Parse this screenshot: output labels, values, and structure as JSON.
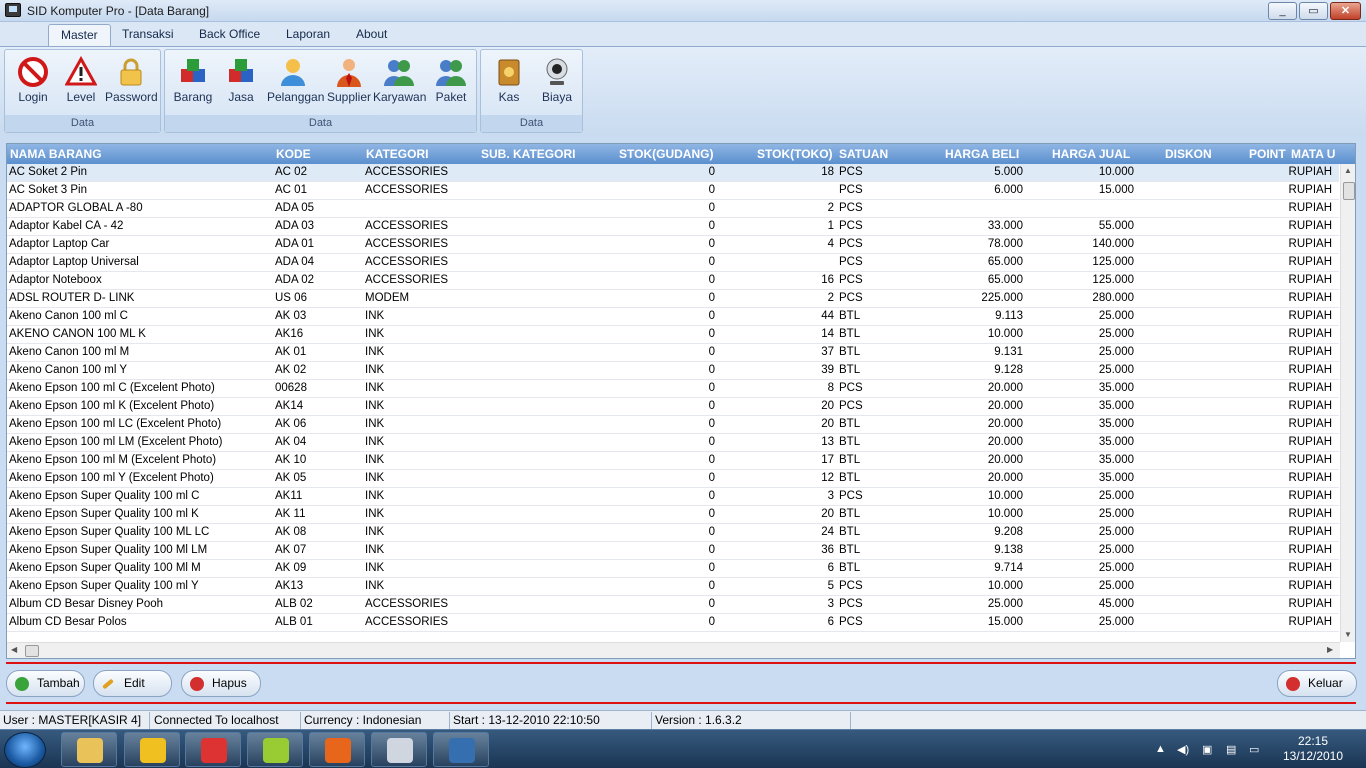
{
  "window": {
    "title": "SID Komputer Pro - [Data Barang]",
    "min": "_",
    "max": "▭",
    "close": "✕"
  },
  "ribbon": {
    "tabs": [
      "Master",
      "Transaksi",
      "Back Office",
      "Laporan",
      "About"
    ],
    "groups": [
      {
        "label": "Data",
        "buttons": [
          {
            "label": "Login",
            "icon": "no-entry-icon"
          },
          {
            "label": "Level",
            "icon": "warning-icon"
          },
          {
            "label": "Password",
            "icon": "padlock-icon"
          }
        ]
      },
      {
        "label": "Data",
        "buttons": [
          {
            "label": "Barang",
            "icon": "cubes-icon"
          },
          {
            "label": "Jasa",
            "icon": "cubes-icon"
          },
          {
            "label": "Pelanggan",
            "icon": "customer-icon"
          },
          {
            "label": "Supplier",
            "icon": "businessman-icon"
          },
          {
            "label": "Karyawan",
            "icon": "users-icon"
          },
          {
            "label": "Paket",
            "icon": "users-icon"
          }
        ]
      },
      {
        "label": "Data",
        "buttons": [
          {
            "label": "Kas",
            "icon": "cash-book-icon"
          },
          {
            "label": "Biaya",
            "icon": "webcam-icon"
          }
        ]
      }
    ]
  },
  "grid": {
    "columns": [
      "NAMA BARANG",
      "KODE",
      "KATEGORI",
      "SUB. KATEGORI",
      "STOK(GUDANG)",
      "STOK(TOKO)",
      "SATUAN",
      "HARGA BELI",
      "HARGA JUAL",
      "DISKON",
      "POINT",
      "MATA U"
    ],
    "rows": [
      [
        "AC Soket 2 Pin",
        "AC 02",
        "ACCESSORIES",
        "",
        "0",
        "18",
        "PCS",
        "5.000",
        "10.000",
        "",
        "",
        "RUPIAH"
      ],
      [
        "AC Soket 3 Pin",
        "AC 01",
        "ACCESSORIES",
        "",
        "0",
        "",
        "PCS",
        "6.000",
        "15.000",
        "",
        "",
        "RUPIAH"
      ],
      [
        "ADAPTOR GLOBAL A -80",
        "ADA 05",
        "",
        "",
        "0",
        "2",
        "PCS",
        "",
        "",
        "",
        "",
        "RUPIAH"
      ],
      [
        "Adaptor Kabel CA - 42",
        "ADA 03",
        "ACCESSORIES",
        "",
        "0",
        "1",
        "PCS",
        "33.000",
        "55.000",
        "",
        "",
        "RUPIAH"
      ],
      [
        "Adaptor Laptop Car",
        "ADA 01",
        "ACCESSORIES",
        "",
        "0",
        "4",
        "PCS",
        "78.000",
        "140.000",
        "",
        "",
        "RUPIAH"
      ],
      [
        "Adaptor Laptop Universal",
        "ADA 04",
        "ACCESSORIES",
        "",
        "0",
        "",
        "PCS",
        "65.000",
        "125.000",
        "",
        "",
        "RUPIAH"
      ],
      [
        "Adaptor Noteboox",
        "ADA 02",
        "ACCESSORIES",
        "",
        "0",
        "16",
        "PCS",
        "65.000",
        "125.000",
        "",
        "",
        "RUPIAH"
      ],
      [
        "ADSL ROUTER D- LINK",
        "US 06",
        "MODEM",
        "",
        "0",
        "2",
        "PCS",
        "225.000",
        "280.000",
        "",
        "",
        "RUPIAH"
      ],
      [
        "Akeno Canon 100 ml C",
        "AK 03",
        "INK",
        "",
        "0",
        "44",
        "BTL",
        "9.113",
        "25.000",
        "",
        "",
        "RUPIAH"
      ],
      [
        "AKENO CANON 100 ML K",
        "AK16",
        "INK",
        "",
        "0",
        "14",
        "BTL",
        "10.000",
        "25.000",
        "",
        "",
        "RUPIAH"
      ],
      [
        "Akeno Canon 100 ml M",
        "AK 01",
        "INK",
        "",
        "0",
        "37",
        "BTL",
        "9.131",
        "25.000",
        "",
        "",
        "RUPIAH"
      ],
      [
        "Akeno Canon 100 ml Y",
        "AK 02",
        "INK",
        "",
        "0",
        "39",
        "BTL",
        "9.128",
        "25.000",
        "",
        "",
        "RUPIAH"
      ],
      [
        "Akeno Epson 100 ml C (Excelent Photo)",
        "00628",
        "INK",
        "",
        "0",
        "8",
        "PCS",
        "20.000",
        "35.000",
        "",
        "",
        "RUPIAH"
      ],
      [
        "Akeno Epson 100 ml K (Excelent Photo)",
        "AK14",
        "INK",
        "",
        "0",
        "20",
        "PCS",
        "20.000",
        "35.000",
        "",
        "",
        "RUPIAH"
      ],
      [
        "Akeno Epson 100 ml LC (Excelent Photo)",
        "AK 06",
        "INK",
        "",
        "0",
        "20",
        "BTL",
        "20.000",
        "35.000",
        "",
        "",
        "RUPIAH"
      ],
      [
        "Akeno Epson 100 ml LM (Excelent Photo)",
        "AK 04",
        "INK",
        "",
        "0",
        "13",
        "BTL",
        "20.000",
        "35.000",
        "",
        "",
        "RUPIAH"
      ],
      [
        "Akeno Epson 100 ml M (Excelent Photo)",
        "AK 10",
        "INK",
        "",
        "0",
        "17",
        "BTL",
        "20.000",
        "35.000",
        "",
        "",
        "RUPIAH"
      ],
      [
        "Akeno Epson 100 ml Y (Excelent Photo)",
        "AK 05",
        "INK",
        "",
        "0",
        "12",
        "BTL",
        "20.000",
        "35.000",
        "",
        "",
        "RUPIAH"
      ],
      [
        "Akeno Epson Super Quality 100 ml C",
        "AK11",
        "INK",
        "",
        "0",
        "3",
        "PCS",
        "10.000",
        "25.000",
        "",
        "",
        "RUPIAH"
      ],
      [
        "Akeno Epson Super Quality 100 ml K",
        "AK 11",
        "INK",
        "",
        "0",
        "20",
        "BTL",
        "10.000",
        "25.000",
        "",
        "",
        "RUPIAH"
      ],
      [
        "Akeno Epson Super Quality 100 ML LC",
        "AK 08",
        "INK",
        "",
        "0",
        "24",
        "BTL",
        "9.208",
        "25.000",
        "",
        "",
        "RUPIAH"
      ],
      [
        "Akeno Epson Super Quality 100 Ml LM",
        "AK 07",
        "INK",
        "",
        "0",
        "36",
        "BTL",
        "9.138",
        "25.000",
        "",
        "",
        "RUPIAH"
      ],
      [
        "Akeno Epson Super Quality 100 Ml M",
        "AK 09",
        "INK",
        "",
        "0",
        "6",
        "BTL",
        "9.714",
        "25.000",
        "",
        "",
        "RUPIAH"
      ],
      [
        "Akeno Epson Super Quality 100 ml Y",
        "AK13",
        "INK",
        "",
        "0",
        "5",
        "PCS",
        "10.000",
        "25.000",
        "",
        "",
        "RUPIAH"
      ],
      [
        "Album CD Besar Disney Pooh",
        "ALB 02",
        "ACCESSORIES",
        "",
        "0",
        "3",
        "PCS",
        "25.000",
        "45.000",
        "",
        "",
        "RUPIAH"
      ],
      [
        "Album CD Besar Polos",
        "ALB 01",
        "ACCESSORIES",
        "",
        "0",
        "6",
        "PCS",
        "15.000",
        "25.000",
        "",
        "",
        "RUPIAH"
      ]
    ]
  },
  "actions": {
    "tambah": "Tambah",
    "edit": "Edit",
    "hapus": "Hapus",
    "keluar": "Keluar"
  },
  "status": {
    "user": "User : MASTER[KASIR 4]",
    "connection": "Connected To localhost",
    "currency": "Currency : Indonesian",
    "start": "Start  : 13-12-2010 22:10:50",
    "version": "Version : 1.6.3.2"
  },
  "taskbar": {
    "apps": [
      {
        "name": "explorer",
        "color": "#e9c35a"
      },
      {
        "name": "app-7",
        "color": "#f0c020"
      },
      {
        "name": "chrome",
        "color": "#d33"
      },
      {
        "name": "hs",
        "color": "#9c3"
      },
      {
        "name": "firefox",
        "color": "#e8661c"
      },
      {
        "name": "monitor",
        "color": "#cfd6df"
      },
      {
        "name": "media",
        "color": "#356fb0"
      }
    ],
    "time": "22:15",
    "date": "13/12/2010"
  }
}
